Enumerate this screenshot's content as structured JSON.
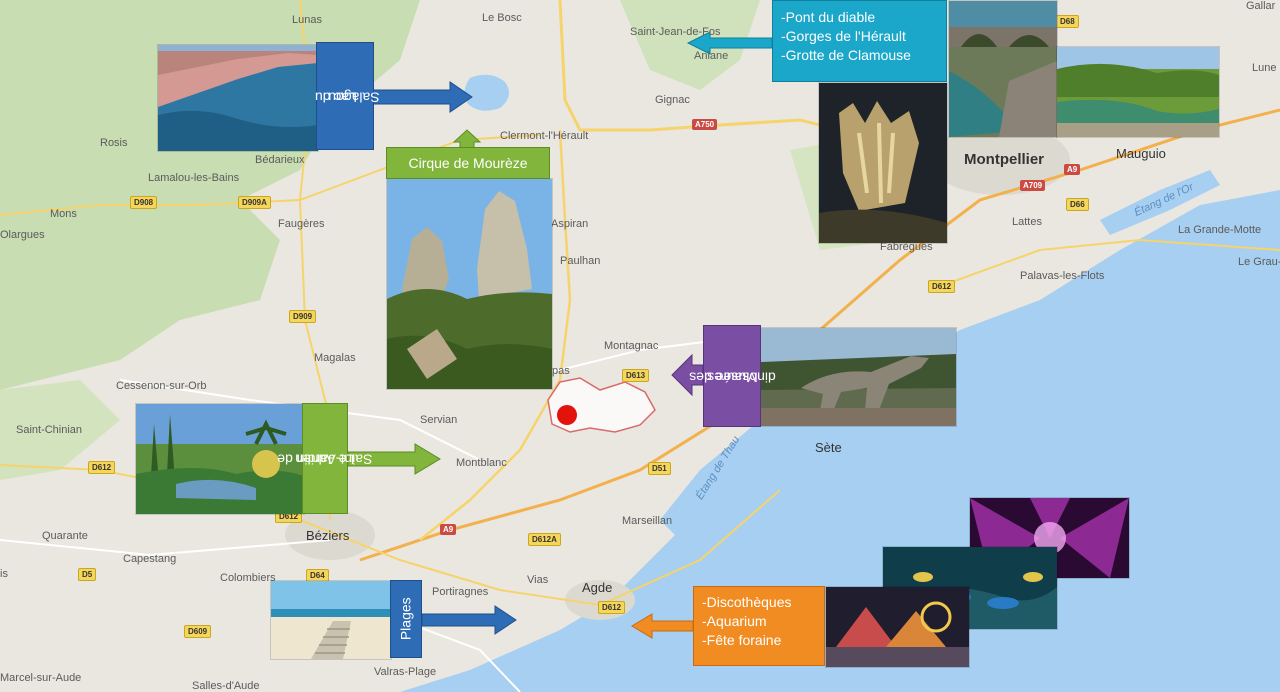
{
  "places": {
    "lunas": "Lunas",
    "le_bosc": "Le Bosc",
    "st_jean": "Saint-Jean-de-Fos",
    "aniane": "Aniane",
    "gignac": "Gignac",
    "clermont": "Clermont-l'Hérault",
    "rosis": "Rosis",
    "bedarieux": "Bédarieux",
    "lamalou": "Lamalou-les-Bains",
    "mons": "Mons",
    "olargues": "Olargues",
    "faugeres": "Faugères",
    "aspiran": "Aspiran",
    "paulhan": "Paulhan",
    "montagnac": "Montagnac",
    "magalas": "Magalas",
    "cessenon": "Cessenon-sur-Orb",
    "servian": "Servian",
    "st_chinian": "Saint-Chinian",
    "montblanc": "Montblanc",
    "beziers": "Béziers",
    "quarante": "Quarante",
    "capestang": "Capestang",
    "colombiers": "Colombiers",
    "portiragnes": "Portiragnes",
    "vias": "Vias",
    "agde": "Agde",
    "marseillan": "Marseillan",
    "sete": "Sète",
    "montpellier": "Montpellier",
    "mauguio": "Mauguio",
    "lattes": "Lattes",
    "fabregues": "Fabrègues",
    "palavas": "Palavas-les-Flots",
    "la_grande_motte": "La Grande-Motte",
    "le_grau": "Le Grau-",
    "lune": "Lune",
    "gallar": "Gallar",
    "valras": "Valras-Plage",
    "marcel": "Marcel-sur-Aude",
    "salles": "Salles-d'Aude",
    "is": "is",
    "pas": "pas",
    "etang_thau": "Étang de Thau",
    "etang_or": "Étang de l'Or"
  },
  "roads": {
    "a750": "A750",
    "d68": "D68",
    "a709": "A709",
    "a9_e": "A9",
    "d66": "D66",
    "d612_e": "D612",
    "d908": "D908",
    "d909a": "D909A",
    "d909": "D909",
    "d613": "D613",
    "d51": "D51",
    "d612_w": "D612",
    "d612_c": "D612",
    "a9_w": "A9",
    "d612a": "D612A",
    "d5": "D5",
    "d64": "D64",
    "d609": "D609",
    "d612_agde": "D612",
    "d61": "D61"
  },
  "callouts": {
    "lac_line1": "Lac du",
    "lac_line2": "Salagou",
    "cirque": "Cirque de Mourèze",
    "pont_1": "-Pont du diable",
    "pont_2": "-Gorges de l'Hérault",
    "pont_3": "-Grotte de Clamouse",
    "musee_line1": "Musée des",
    "musee_line2": "dinosaures",
    "jardin_line1": "Le Jardin de",
    "jardin_line2": "Saint-Adrien",
    "plages": "Plages",
    "disco_1": "-Discothèques",
    "disco_2": "-Aquarium",
    "disco_3": "-Fête foraine"
  },
  "colors": {
    "land": "#e8e6df",
    "forest": "#c5dcae",
    "sea": "#a6cff2",
    "callout_blue": "#2e6cb5",
    "callout_green": "#82b53c",
    "callout_purple": "#7a4ea3",
    "callout_orange": "#f08c22",
    "callout_cyan": "#1aa7c9",
    "marker": "#e3120b"
  }
}
